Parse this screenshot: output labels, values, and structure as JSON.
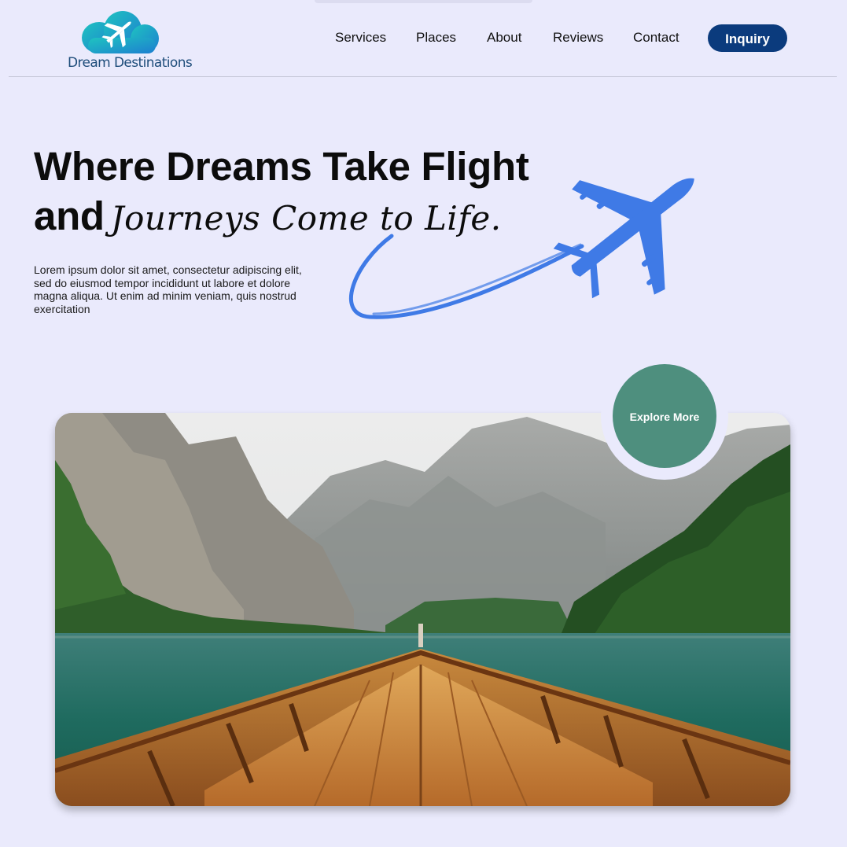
{
  "brand": {
    "name": "Dream Destinations",
    "logo_icon": "cloud-airplane-icon"
  },
  "nav": {
    "items": [
      {
        "label": "Services"
      },
      {
        "label": "Places"
      },
      {
        "label": "About"
      },
      {
        "label": "Reviews"
      },
      {
        "label": "Contact"
      }
    ],
    "cta_label": "Inquiry"
  },
  "hero": {
    "title_line1": "Where Dreams Take Flight",
    "title_line2_bold": "and",
    "title_line2_script": "Journeys Come to Life.",
    "description": "Lorem ipsum dolor sit amet, consectetur adipiscing elit, sed do eiusmod tempor incididunt ut labore et dolore magna aliqua. Ut enim ad minim veniam, quis nostrud exercitation",
    "illustration_icon": "airplane-icon"
  },
  "feature": {
    "image_subject": "wooden boat on a mountain lake",
    "explore_label": "Explore More"
  },
  "colors": {
    "background": "#eaeafc",
    "primary_button": "#0b3b7d",
    "explore_button": "#4e8f7e",
    "plane_blue": "#3f7ae6"
  }
}
